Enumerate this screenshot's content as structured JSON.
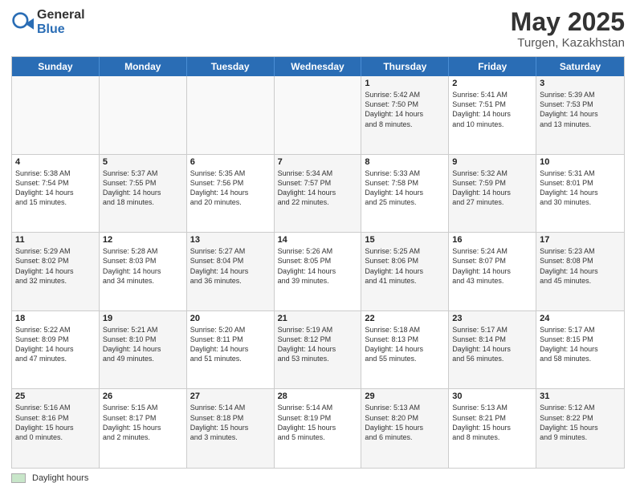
{
  "header": {
    "logo_general": "General",
    "logo_blue": "Blue",
    "month": "May 2025",
    "location": "Turgen, Kazakhstan"
  },
  "calendar": {
    "days_of_week": [
      "Sunday",
      "Monday",
      "Tuesday",
      "Wednesday",
      "Thursday",
      "Friday",
      "Saturday"
    ],
    "weeks": [
      [
        {
          "day": "",
          "info": "",
          "empty": true
        },
        {
          "day": "",
          "info": "",
          "empty": true
        },
        {
          "day": "",
          "info": "",
          "empty": true
        },
        {
          "day": "",
          "info": "",
          "empty": true
        },
        {
          "day": "1",
          "info": "Sunrise: 5:42 AM\nSunset: 7:50 PM\nDaylight: 14 hours\nand 8 minutes."
        },
        {
          "day": "2",
          "info": "Sunrise: 5:41 AM\nSunset: 7:51 PM\nDaylight: 14 hours\nand 10 minutes."
        },
        {
          "day": "3",
          "info": "Sunrise: 5:39 AM\nSunset: 7:53 PM\nDaylight: 14 hours\nand 13 minutes."
        }
      ],
      [
        {
          "day": "4",
          "info": "Sunrise: 5:38 AM\nSunset: 7:54 PM\nDaylight: 14 hours\nand 15 minutes."
        },
        {
          "day": "5",
          "info": "Sunrise: 5:37 AM\nSunset: 7:55 PM\nDaylight: 14 hours\nand 18 minutes."
        },
        {
          "day": "6",
          "info": "Sunrise: 5:35 AM\nSunset: 7:56 PM\nDaylight: 14 hours\nand 20 minutes."
        },
        {
          "day": "7",
          "info": "Sunrise: 5:34 AM\nSunset: 7:57 PM\nDaylight: 14 hours\nand 22 minutes."
        },
        {
          "day": "8",
          "info": "Sunrise: 5:33 AM\nSunset: 7:58 PM\nDaylight: 14 hours\nand 25 minutes."
        },
        {
          "day": "9",
          "info": "Sunrise: 5:32 AM\nSunset: 7:59 PM\nDaylight: 14 hours\nand 27 minutes."
        },
        {
          "day": "10",
          "info": "Sunrise: 5:31 AM\nSunset: 8:01 PM\nDaylight: 14 hours\nand 30 minutes."
        }
      ],
      [
        {
          "day": "11",
          "info": "Sunrise: 5:29 AM\nSunset: 8:02 PM\nDaylight: 14 hours\nand 32 minutes."
        },
        {
          "day": "12",
          "info": "Sunrise: 5:28 AM\nSunset: 8:03 PM\nDaylight: 14 hours\nand 34 minutes."
        },
        {
          "day": "13",
          "info": "Sunrise: 5:27 AM\nSunset: 8:04 PM\nDaylight: 14 hours\nand 36 minutes."
        },
        {
          "day": "14",
          "info": "Sunrise: 5:26 AM\nSunset: 8:05 PM\nDaylight: 14 hours\nand 39 minutes."
        },
        {
          "day": "15",
          "info": "Sunrise: 5:25 AM\nSunset: 8:06 PM\nDaylight: 14 hours\nand 41 minutes."
        },
        {
          "day": "16",
          "info": "Sunrise: 5:24 AM\nSunset: 8:07 PM\nDaylight: 14 hours\nand 43 minutes."
        },
        {
          "day": "17",
          "info": "Sunrise: 5:23 AM\nSunset: 8:08 PM\nDaylight: 14 hours\nand 45 minutes."
        }
      ],
      [
        {
          "day": "18",
          "info": "Sunrise: 5:22 AM\nSunset: 8:09 PM\nDaylight: 14 hours\nand 47 minutes."
        },
        {
          "day": "19",
          "info": "Sunrise: 5:21 AM\nSunset: 8:10 PM\nDaylight: 14 hours\nand 49 minutes."
        },
        {
          "day": "20",
          "info": "Sunrise: 5:20 AM\nSunset: 8:11 PM\nDaylight: 14 hours\nand 51 minutes."
        },
        {
          "day": "21",
          "info": "Sunrise: 5:19 AM\nSunset: 8:12 PM\nDaylight: 14 hours\nand 53 minutes."
        },
        {
          "day": "22",
          "info": "Sunrise: 5:18 AM\nSunset: 8:13 PM\nDaylight: 14 hours\nand 55 minutes."
        },
        {
          "day": "23",
          "info": "Sunrise: 5:17 AM\nSunset: 8:14 PM\nDaylight: 14 hours\nand 56 minutes."
        },
        {
          "day": "24",
          "info": "Sunrise: 5:17 AM\nSunset: 8:15 PM\nDaylight: 14 hours\nand 58 minutes."
        }
      ],
      [
        {
          "day": "25",
          "info": "Sunrise: 5:16 AM\nSunset: 8:16 PM\nDaylight: 15 hours\nand 0 minutes."
        },
        {
          "day": "26",
          "info": "Sunrise: 5:15 AM\nSunset: 8:17 PM\nDaylight: 15 hours\nand 2 minutes."
        },
        {
          "day": "27",
          "info": "Sunrise: 5:14 AM\nSunset: 8:18 PM\nDaylight: 15 hours\nand 3 minutes."
        },
        {
          "day": "28",
          "info": "Sunrise: 5:14 AM\nSunset: 8:19 PM\nDaylight: 15 hours\nand 5 minutes."
        },
        {
          "day": "29",
          "info": "Sunrise: 5:13 AM\nSunset: 8:20 PM\nDaylight: 15 hours\nand 6 minutes."
        },
        {
          "day": "30",
          "info": "Sunrise: 5:13 AM\nSunset: 8:21 PM\nDaylight: 15 hours\nand 8 minutes."
        },
        {
          "day": "31",
          "info": "Sunrise: 5:12 AM\nSunset: 8:22 PM\nDaylight: 15 hours\nand 9 minutes."
        }
      ]
    ]
  },
  "footer": {
    "legend_label": "Daylight hours"
  }
}
